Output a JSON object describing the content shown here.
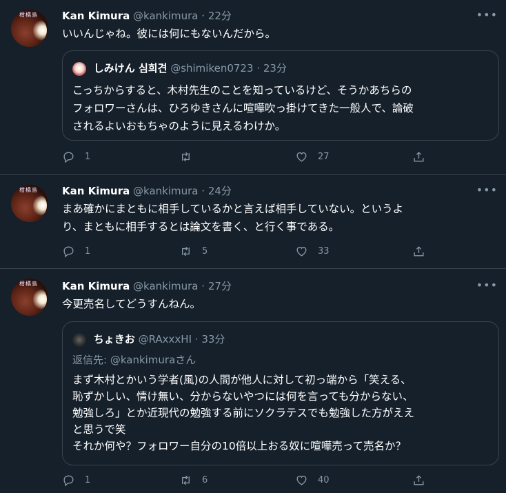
{
  "tweets": [
    {
      "name": "Kan Kimura",
      "handle": "@kankimura",
      "time": "22分",
      "text": "いいんじゃね。彼には何にもないんだから。",
      "quote": {
        "name": "しみけん 심희견",
        "handle": "@shimiken0723",
        "time": "23分",
        "text": "こっちからすると、木村先生のことを知っているけど、そうかあちらの\nフォロワーさんは、ひろゆきさんに喧嘩吹っ掛けてきた一般人で、論破\nされるよいおもちゃのように見えるわけか。"
      },
      "actions": {
        "replies": "1",
        "retweets": "",
        "likes": "27"
      }
    },
    {
      "name": "Kan Kimura",
      "handle": "@kankimura",
      "time": "24分",
      "text": "まあ確かにまともに相手しているかと言えば相手していない。というよ\nり、まともに相手するとは論文を書く、と行く事である。",
      "actions": {
        "replies": "1",
        "retweets": "5",
        "likes": "33"
      }
    },
    {
      "name": "Kan Kimura",
      "handle": "@kankimura",
      "time": "27分",
      "text": "今更売名してどうすんねん。",
      "quote": {
        "name": "ちょきお",
        "handle": "@RAxxxHI",
        "time": "33分",
        "reply_prefix": "返信先: ",
        "reply_mention": "@kankimura",
        "reply_suffix": "さん",
        "text": "まず木村とかいう学者(風)の人間が他人に対して初っ端から「笑える、\n恥ずかしい、情け無い、分からないやつには何を言っても分からない、\n勉強しろ」とか近現代の勉強する前にソクラテスでも勉強した方がええ\nと思うで笑\nそれか何や？フォロワー自分の10倍以上おる奴に喧嘩売って売名か？"
      },
      "actions": {
        "replies": "1",
        "retweets": "6",
        "likes": "40"
      }
    }
  ],
  "ui": {
    "avatar_tag": "柑橘島",
    "dot": "·",
    "more": "•••"
  },
  "icons": [
    "reply-icon",
    "retweet-icon",
    "like-icon",
    "share-icon",
    "more-icon"
  ],
  "colors": {
    "background": "#15202b",
    "divider": "#38444d",
    "secondary": "#8899a6",
    "primary": "#ffffff"
  }
}
